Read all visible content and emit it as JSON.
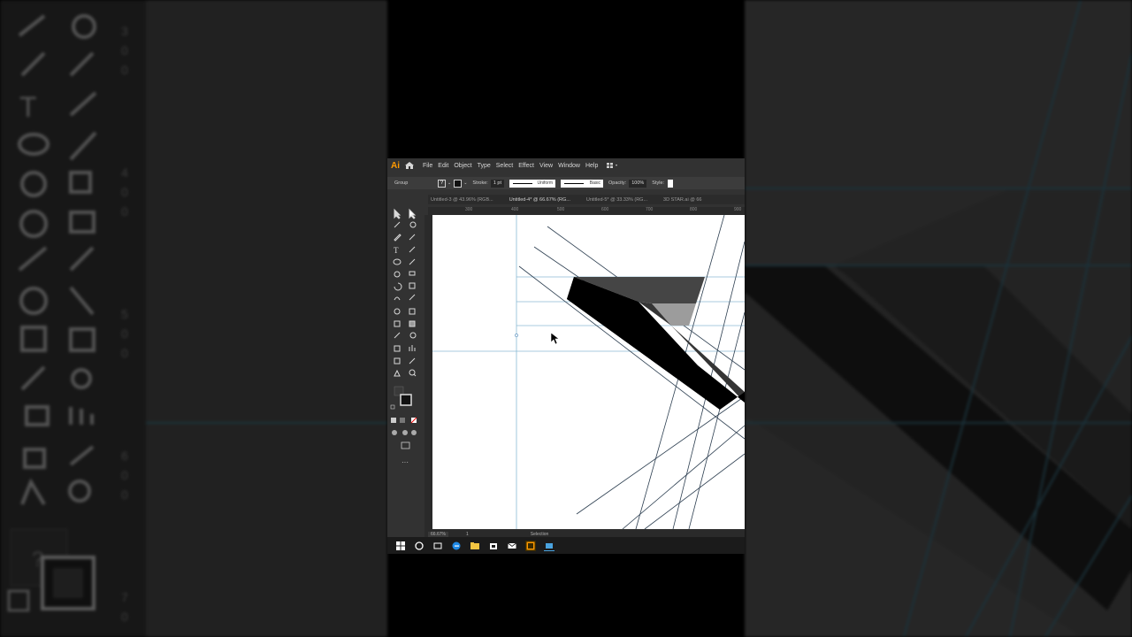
{
  "app": {
    "logo": "Ai",
    "menu": [
      "File",
      "Edit",
      "Object",
      "Type",
      "Select",
      "Effect",
      "View",
      "Window",
      "Help"
    ]
  },
  "control_bar": {
    "selection_type": "Group",
    "fill_value": "?",
    "stroke_label": "Stroke:",
    "stroke_weight": "1 pt",
    "stroke_profile": "Uniform",
    "brush": "Basic",
    "opacity_label": "Opacity:",
    "opacity_value": "100%",
    "style_label": "Style:"
  },
  "tabs": [
    "Untitled-3 @ 43.96% (RGB...",
    "Untitled-4* @ 66.67% (RG...",
    "Untitled-5* @ 33.33% (RG...",
    "3D STAR.ai @ 66"
  ],
  "ruler": {
    "h_ticks": [
      "300",
      "400",
      "500",
      "600",
      "700",
      "800",
      "900"
    ]
  },
  "status_bar": {
    "zoom": "66.67%",
    "page": "1",
    "mode": "Selection"
  },
  "colors": {
    "accent": "#ff9a00",
    "canvas": "#ffffff",
    "guide": "#7fb6d6",
    "shape_dark": "#000000",
    "shape_mid": "#454545",
    "shape_light": "#9c9c9c"
  },
  "icons": {
    "home": "home-icon",
    "workspace": "workspace-switcher-icon",
    "cursor": "arrow-cursor-icon"
  }
}
